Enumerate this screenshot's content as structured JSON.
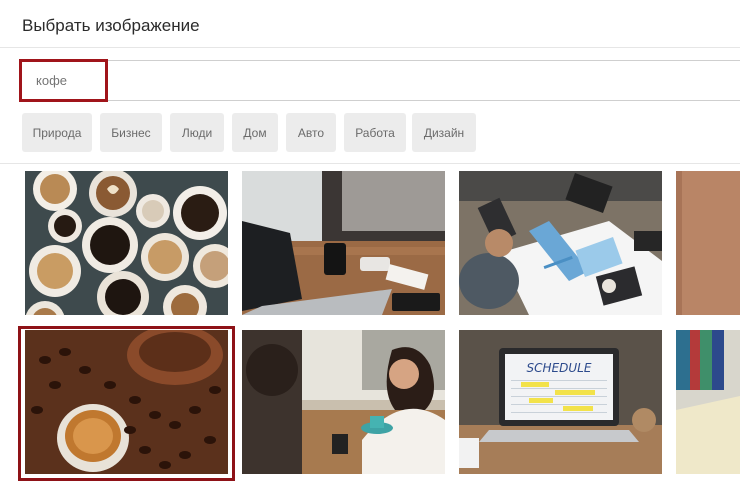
{
  "dialog": {
    "title": "Выбрать изображение"
  },
  "search": {
    "value": "",
    "placeholder": "кофе"
  },
  "categories": [
    "Природа",
    "Бизнес",
    "Люди",
    "Дом",
    "Авто",
    "Работа",
    "Дизайн"
  ],
  "images": [
    {
      "name": "coffee-cups-overhead",
      "selected": false
    },
    {
      "name": "laptop-desk-coffee",
      "selected": false
    },
    {
      "name": "business-meeting-charts",
      "selected": false
    },
    {
      "name": "brown-partial",
      "selected": false
    },
    {
      "name": "coffee-beans-cup",
      "selected": true
    },
    {
      "name": "cafe-conversation",
      "selected": false
    },
    {
      "name": "laptop-schedule",
      "selected": false
    },
    {
      "name": "office-binders-partial",
      "selected": false
    }
  ],
  "screen_texts": {
    "schedule_label": "SCHEDULE"
  },
  "colors": {
    "selection": "#a0141a",
    "chip_bg": "#ececec",
    "chip_text": "#6b6b6b"
  }
}
